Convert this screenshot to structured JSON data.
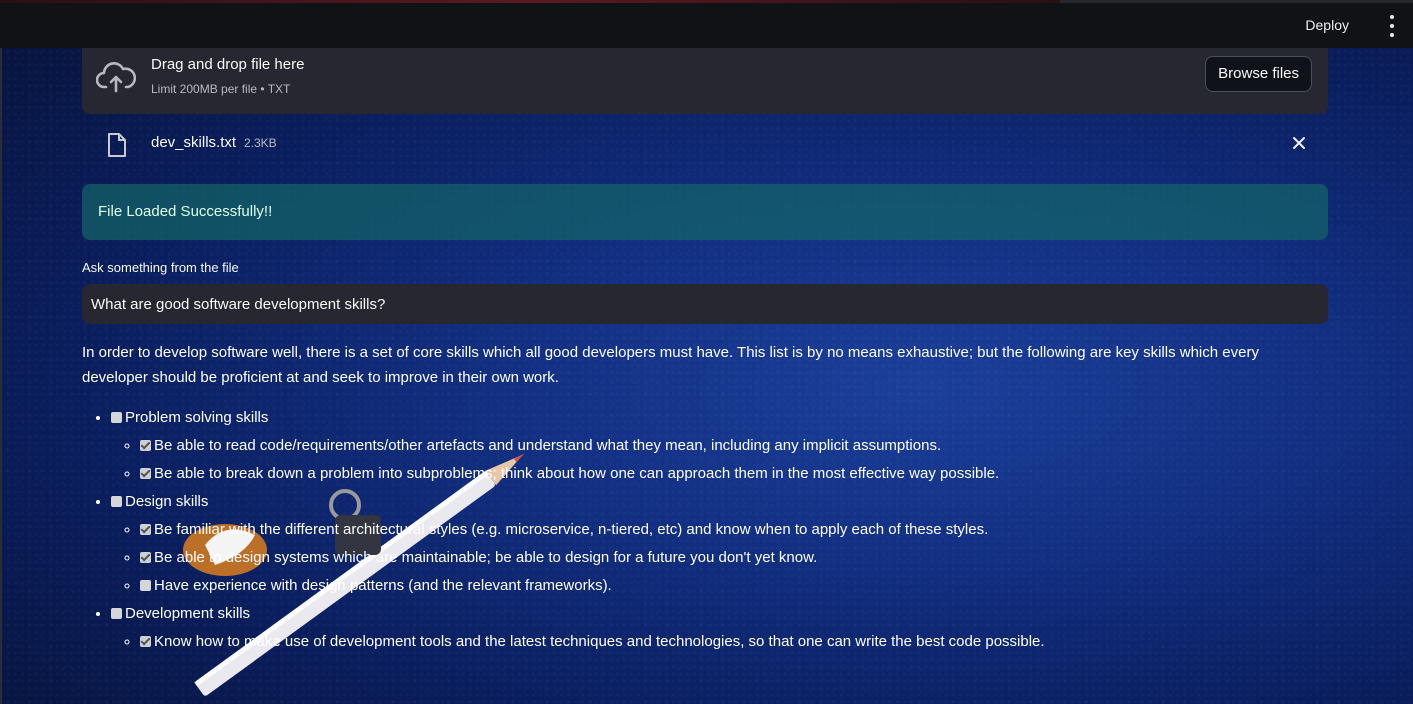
{
  "toolbar": {
    "deploy_label": "Deploy",
    "menu_icon": "kebab-menu-icon"
  },
  "uploader": {
    "icon": "cloud-upload-icon",
    "title": "Drag and drop file here",
    "subtitle": "Limit 200MB per file • TXT",
    "browse_label": "Browse files"
  },
  "uploaded_file": {
    "icon": "file-icon",
    "name": "dev_skills.txt",
    "size": "2.3KB",
    "remove_icon": "close-icon"
  },
  "alert": {
    "message": "File Loaded Successfully!!",
    "color": "#156967"
  },
  "question": {
    "label": "Ask something from the file",
    "value": "What are good software development skills?"
  },
  "answer": {
    "intro": "In order to develop software well, there is a set of core skills which all good developers must have. This list is by no means exhaustive; but the following are key skills which every developer should be proficient at and seek to improve in their own work.",
    "sections": [
      {
        "title": "Problem solving skills",
        "checked": false,
        "items": [
          {
            "text": "Be able to read code/requirements/other artefacts and understand what they mean, including any implicit assumptions.",
            "checked": true
          },
          {
            "text": "Be able to break down a problem into subproblems; think about how one can approach them in the most effective way possible.",
            "checked": true
          }
        ]
      },
      {
        "title": "Design skills",
        "checked": false,
        "items": [
          {
            "text": "Be familiar with the different architectural styles (e.g. microservice, n-tiered, etc) and know when to apply each of these styles.",
            "checked": true
          },
          {
            "text": "Be able to design systems which are maintainable; be able to design for a future you don't yet know.",
            "checked": true
          },
          {
            "text": "Have experience with design patterns (and the relevant frameworks).",
            "checked": false
          }
        ]
      },
      {
        "title": "Development skills",
        "checked": false,
        "items": [
          {
            "text": "Know how to make use of development tools and the latest techniques and technologies, so that one can write the best code possible.",
            "checked": true
          }
        ]
      }
    ]
  }
}
